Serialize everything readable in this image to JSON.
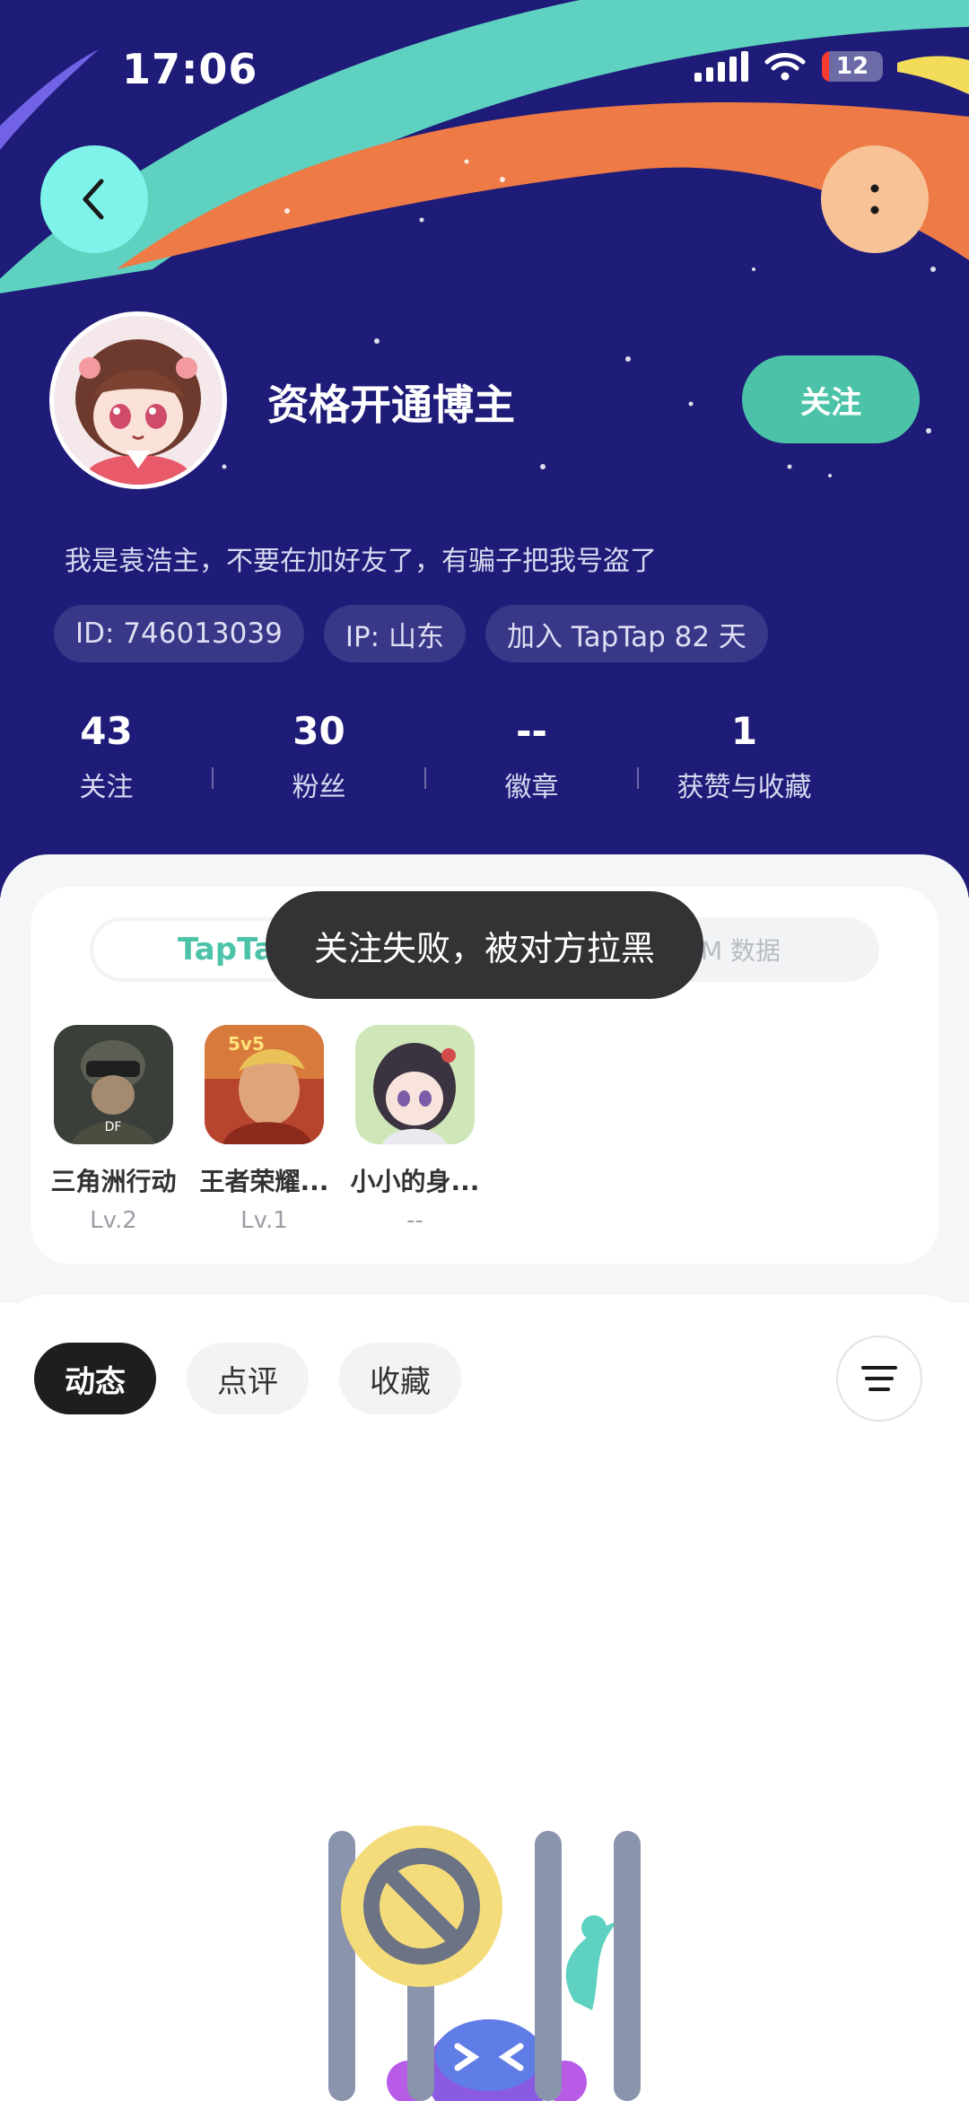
{
  "status_bar": {
    "time": "17:06",
    "battery": "12"
  },
  "profile": {
    "username": "资格开通博主",
    "follow_label": "关注",
    "bio": "我是袁浩主，不要在加好友了，有骗子把我号盗了",
    "chips": [
      "ID: 746013039",
      "IP: 山东",
      "加入 TapTap 82 天"
    ],
    "stats": [
      {
        "value": "43",
        "label": "关注"
      },
      {
        "value": "30",
        "label": "粉丝"
      },
      {
        "value": "--",
        "label": "徽章"
      },
      {
        "value": "1",
        "label": "获赞与收藏"
      }
    ]
  },
  "data_card": {
    "segment_active": "TapTa",
    "segment_other": "M 数据",
    "games": [
      {
        "name": "三角洲行动",
        "level": "Lv.2"
      },
      {
        "name": "王者荣耀...",
        "level": "Lv.1"
      },
      {
        "name": "小小的身...",
        "level": "--"
      }
    ]
  },
  "toast": "关注失败，被对方拉黑",
  "tabs": [
    "动态",
    "点评",
    "收藏"
  ],
  "icons": {
    "back": "chevron-left-icon",
    "more": "more-vertical-icon",
    "filter": "filter-icon",
    "wifi": "wifi-icon",
    "signal": "signal-icon"
  },
  "colors": {
    "header_bg": "#1e1c78",
    "accent": "#4cc3a8",
    "toast_bg": "#333335"
  }
}
